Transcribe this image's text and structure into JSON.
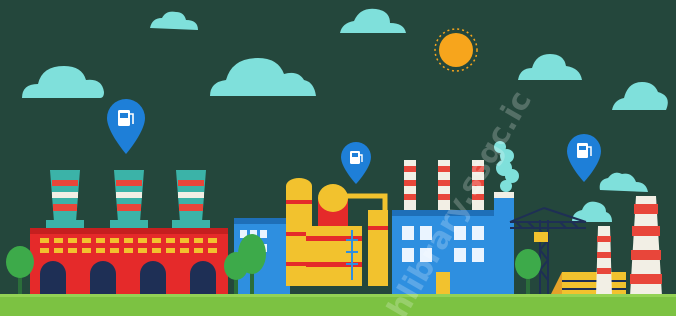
{
  "scene": {
    "title": "",
    "watermark_text": "hlibrary.ssgc.ic",
    "icons": [
      "fuel-pin-icon",
      "fuel-pin-icon",
      "fuel-pin-icon",
      "sun-icon",
      "cloud-icon",
      "tree-icon",
      "crane-icon",
      "truck-icon"
    ],
    "colors": {
      "background": "#24473C",
      "cloud": "#7FE0DB",
      "sun": "#F7A51C",
      "factory_red": "#E52A2A",
      "stripe_white": "#F2EFE5",
      "stripe_red": "#E8463A",
      "stack_teal": "#3BB3A8",
      "refinery_yellow": "#F2C22E",
      "building_blue": "#2E8FE0",
      "pin_blue": "#1E7FD8",
      "ground_green": "#7CC242",
      "tree_green": "#3DAA4A"
    }
  }
}
